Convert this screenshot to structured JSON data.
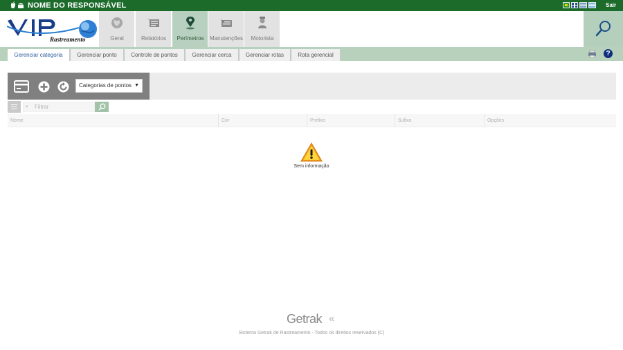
{
  "topbar": {
    "os_icons": "",
    "responsible_name": "NOME DO RESPONSÁVEL",
    "logout_label": "Sair",
    "flags": [
      "flag-brazil-icon",
      "flag-uk-icon",
      "flag-spain-icon",
      "flag-argentina-icon"
    ]
  },
  "logo": {
    "main": "VIP",
    "sub": "Rastreamento"
  },
  "nav": {
    "items": [
      {
        "label": "Geral",
        "icon": "globe-icon"
      },
      {
        "label": "Relatórios",
        "icon": "reports-icon"
      },
      {
        "label": "Perímetros",
        "icon": "map-pin-icon",
        "active": true
      },
      {
        "label": "Manutenções",
        "icon": "maintenance-icon"
      },
      {
        "label": "Motorista",
        "icon": "driver-icon"
      }
    ],
    "search_icon": "search-icon"
  },
  "subtabs": [
    {
      "label": "Gerenciar categoria",
      "active": true
    },
    {
      "label": "Gerenciar ponto"
    },
    {
      "label": "Controle de pontos"
    },
    {
      "label": "Gerenciar cerca"
    },
    {
      "label": "Gerenciar rotas"
    },
    {
      "label": "Rota gerencial"
    }
  ],
  "toolbar": {
    "category_select": "Categorias de pontos"
  },
  "filter": {
    "placeholder": "Filtrar"
  },
  "table": {
    "columns": [
      "Nome",
      "Cor",
      "Prefixo",
      "Sufixo",
      "Opções"
    ],
    "empty_message": "Sem informação"
  },
  "footer": {
    "brand": "Getrak",
    "copyright": "Sistema Getrak de Rastreamento - Todos os direitos reservados (C)"
  },
  "colors": {
    "topbar": "#1c6b2b",
    "active_tab": "#b8d0bf",
    "subtab_bar": "#b7d1bc",
    "toolbar": "#808080",
    "warning": "#f0a020"
  }
}
